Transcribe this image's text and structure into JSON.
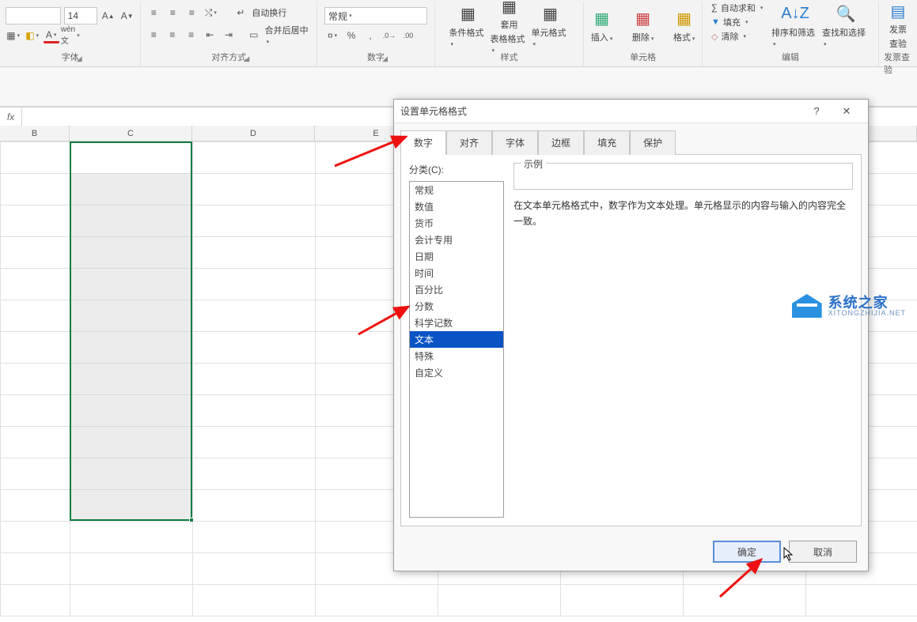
{
  "ribbon": {
    "font_size": "14",
    "groups": {
      "font": "字体",
      "align": "对齐方式",
      "wrap": "自动换行",
      "merge": "合并后居中",
      "numberformat_combo": "常规",
      "number": "数字",
      "cond_fmt_top": "条件格式",
      "cond_fmt_bot": "",
      "table_fmt_top": "套用",
      "table_fmt_bot": "表格格式",
      "cell_fmt_top": "单元格式",
      "cell_fmt_bot": "",
      "styles": "样式",
      "insert": "插入",
      "delete": "删除",
      "format": "格式",
      "cells": "单元格",
      "autosum": "自动求和",
      "fill": "填充",
      "clear": "清除",
      "sortfilter": "排序和筛选",
      "findselect": "查找和选择",
      "editing": "编辑",
      "invoice_top": "发票",
      "invoice_bot": "查验",
      "invoice_grp": "发票查验"
    }
  },
  "columns": [
    "B",
    "C",
    "D",
    "E"
  ],
  "dialog": {
    "title": "设置单元格格式",
    "tabs": [
      "数字",
      "对齐",
      "字体",
      "边框",
      "填充",
      "保护"
    ],
    "category_label": "分类(C):",
    "categories": [
      "常规",
      "数值",
      "货币",
      "会计专用",
      "日期",
      "时间",
      "百分比",
      "分数",
      "科学记数",
      "文本",
      "特殊",
      "自定义"
    ],
    "selected_category": "文本",
    "sample_label": "示例",
    "description": "在文本单元格格式中，数字作为文本处理。单元格显示的内容与输入的内容完全一致。",
    "ok": "确定",
    "cancel": "取消"
  },
  "logo": {
    "cn": "系统之家",
    "en": "XITONGZHIJIA.NET"
  }
}
